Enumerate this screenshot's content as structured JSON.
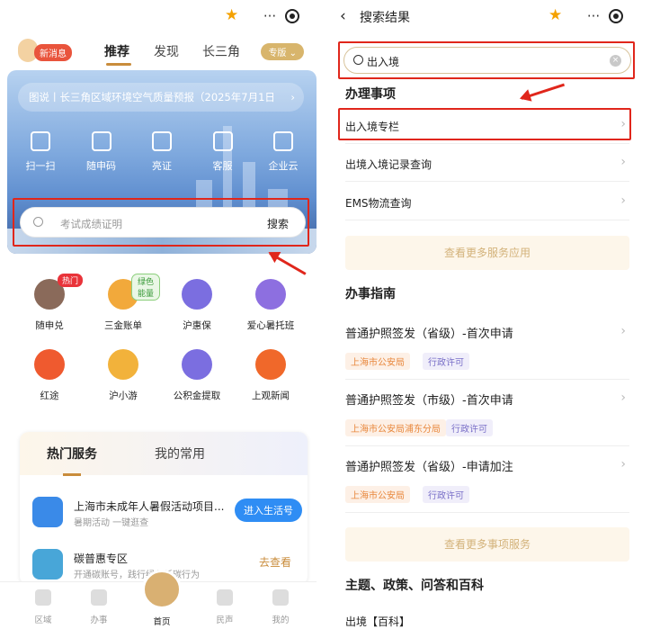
{
  "left": {
    "capsule": {
      "more": "···"
    },
    "new_message": "新消息",
    "tabs": [
      "推荐",
      "发现",
      "长三角"
    ],
    "zhuanban": "专版",
    "notice": "图说丨长三角区域环境空气质量预报（2025年7月1日",
    "quick": [
      "扫一扫",
      "随申码",
      "亮证",
      "客服",
      "企业云"
    ],
    "search": {
      "placeholder": "考试成绩证明",
      "button": "搜索"
    },
    "grid": [
      {
        "label": "随申兑",
        "badge": "热门",
        "color": "#8a6a5a"
      },
      {
        "label": "三金账单",
        "badge": "绿色能量",
        "color": "#f2a93b"
      },
      {
        "label": "沪惠保",
        "badge": "",
        "color": "#7b6ee0"
      },
      {
        "label": "爱心暑托班",
        "badge": "",
        "color": "#8d6fe0"
      },
      {
        "label": "红途",
        "badge": "",
        "color": "#ef5a2f"
      },
      {
        "label": "沪小游",
        "badge": "",
        "color": "#f2b23b"
      },
      {
        "label": "公积金提取",
        "badge": "",
        "color": "#7b6ee0"
      },
      {
        "label": "上观新闻",
        "badge": "",
        "color": "#f0682a"
      }
    ],
    "hot_tabs": [
      "热门服务",
      "我的常用"
    ],
    "services": [
      {
        "title": "上海市未成年人暑假活动项目...",
        "sub": "暑期活动 一键逛查",
        "action": "进入生活号"
      },
      {
        "title": "碳普惠专区",
        "sub": "开通碳账号，践行绿色低碳行为",
        "action": "去查看"
      }
    ],
    "bottom_nav": [
      "区域",
      "办事",
      "首页",
      "民声",
      "我的"
    ]
  },
  "right": {
    "title": "搜索结果",
    "capsule": {
      "more": "···"
    },
    "query": "出入境",
    "section1": "办理事项",
    "items": [
      "出入境专栏",
      "出境入境记录查询",
      "EMS物流查询"
    ],
    "more_apps": "查看更多服务应用",
    "section2": "办事指南",
    "guides": [
      {
        "title": "普通护照签发（省级）-首次申请",
        "org": "上海市公安局",
        "kind": "行政许可"
      },
      {
        "title": "普通护照签发（市级）-首次申请",
        "org": "上海市公安局浦东分局",
        "kind": "行政许可"
      },
      {
        "title": "普通护照签发（省级）-申请加注",
        "org": "上海市公安局",
        "kind": "行政许可"
      }
    ],
    "more_items": "查看更多事项服务",
    "section3": "主题、政策、问答和百科",
    "wiki": "出境【百科】"
  },
  "colors": {
    "accent": "#c98c3b",
    "highlight": "#e0261b",
    "star": "#f4a100"
  }
}
